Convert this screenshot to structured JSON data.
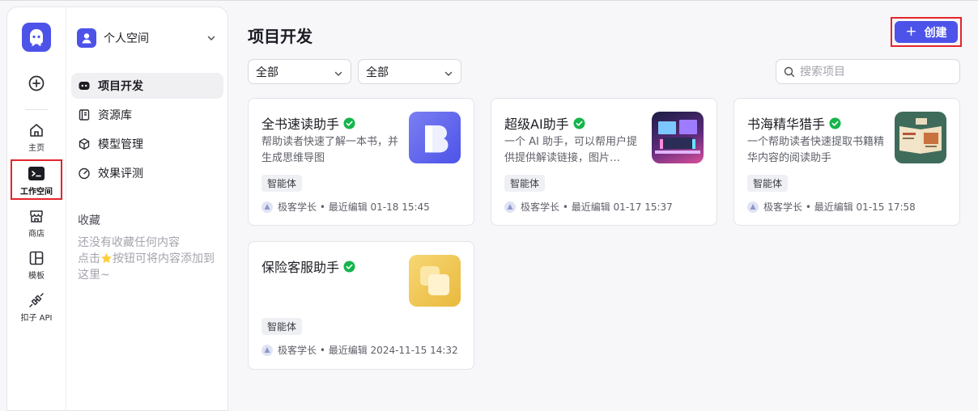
{
  "rail": {
    "items": [
      {
        "label": "主页",
        "icon": "home-icon"
      },
      {
        "label": "工作空间",
        "icon": "terminal-icon"
      },
      {
        "label": "商店",
        "icon": "store-icon"
      },
      {
        "label": "模板",
        "icon": "template-icon"
      },
      {
        "label": "扣子 API",
        "icon": "api-icon"
      }
    ]
  },
  "sidebar": {
    "space_name": "个人空间",
    "nav": [
      {
        "label": "项目开发",
        "icon": "bot-icon"
      },
      {
        "label": "资源库",
        "icon": "library-icon"
      },
      {
        "label": "模型管理",
        "icon": "cube-icon"
      },
      {
        "label": "效果评测",
        "icon": "gauge-icon"
      }
    ],
    "favorites_title": "收藏",
    "favorites_empty_1": "还没有收藏任何内容",
    "favorites_empty_2a": "点击",
    "favorites_empty_2b": "按钮可将内容添加到",
    "favorites_empty_3": "这里~"
  },
  "main": {
    "title": "项目开发",
    "create_label": "创建",
    "filter1": "全部",
    "filter2": "全部",
    "search_placeholder": "搜索项目"
  },
  "projects": [
    {
      "name": "全书速读助手",
      "desc": "帮助读者快速了解一本书，并生成思维导图",
      "tag": "智能体",
      "author": "极客学长",
      "edited": "最近编辑 01-18 15:45"
    },
    {
      "name": "超级AI助手",
      "desc": "一个 AI 助手，可以帮用户提供提供解读链接，图片…",
      "tag": "智能体",
      "author": "极客学长",
      "edited": "最近编辑 01-17 15:37"
    },
    {
      "name": "书海精华猎手",
      "desc": "一个帮助读者快速提取书籍精华内容的阅读助手",
      "tag": "智能体",
      "author": "极客学长",
      "edited": "最近编辑 01-15 17:58"
    },
    {
      "name": "保险客服助手",
      "desc": "",
      "tag": "智能体",
      "author": "极客学长",
      "edited": "最近编辑 2024-11-15 14:32"
    }
  ],
  "colors": {
    "accent": "#4d53e8",
    "verified": "#16b44c",
    "highlight": "#e4252b"
  }
}
